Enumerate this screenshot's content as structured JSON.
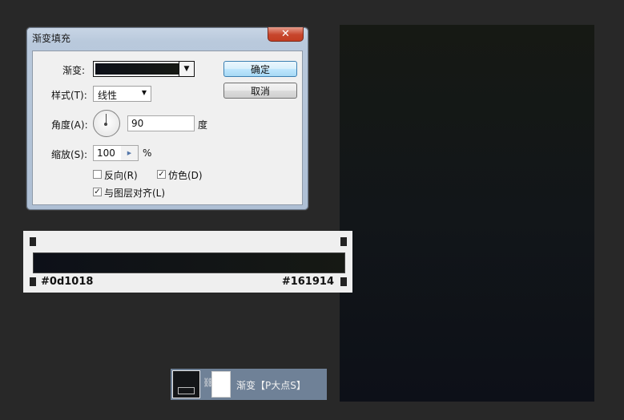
{
  "dialog": {
    "title": "渐变填充",
    "close_glyph": "✕",
    "gradient_label": "渐变:",
    "gradient_arrow": "▼",
    "ok_label": "确定",
    "cancel_label": "取消",
    "style_label": "样式(T):",
    "style_value": "线性",
    "style_arrow": "▼",
    "angle_label": "角度(A):",
    "angle_value": "90",
    "angle_unit": "度",
    "scale_label": "缩放(S):",
    "scale_value": "100",
    "scale_spin": "▶",
    "scale_unit": "%",
    "reverse_label": "反向(R)",
    "reverse_checked": false,
    "dither_label": "仿色(D)",
    "dither_checked": true,
    "align_label": "与图层对齐(L)",
    "align_checked": true,
    "check_glyph": "✓"
  },
  "gradient_editor": {
    "left_color": "#0d1018",
    "right_color": "#161914"
  },
  "layer": {
    "name": "渐变【P大点S】",
    "link_glyph": "⛓"
  }
}
